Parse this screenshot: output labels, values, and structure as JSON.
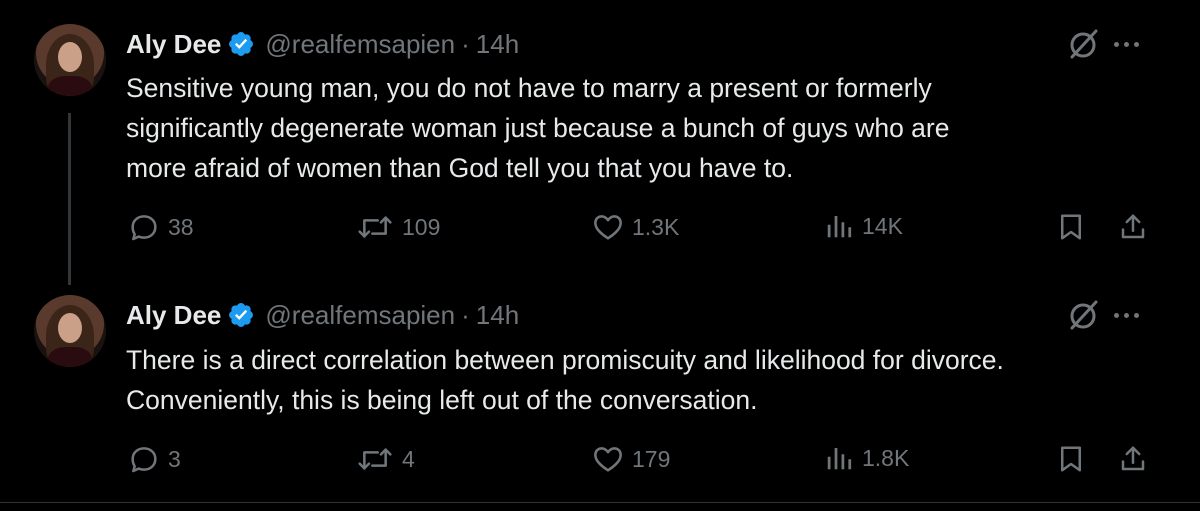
{
  "tweets": [
    {
      "name": "Aly Dee",
      "handle": "@realfemsapien",
      "separator": "·",
      "time": "14h",
      "lines": [
        "Sensitive young man, you do not have to marry a present or formerly",
        "significantly degenerate woman just because a bunch of guys who are",
        "more afraid of women than God tell you that you have to."
      ],
      "replies": "38",
      "retweets": "109",
      "likes": "1.3K",
      "views": "14K"
    },
    {
      "name": "Aly Dee",
      "handle": "@realfemsapien",
      "separator": "·",
      "time": "14h",
      "lines": [
        "There is a direct correlation between promiscuity and likelihood for divorce.",
        "Conveniently, this is being left out of the conversation."
      ],
      "replies": "3",
      "retweets": "4",
      "likes": "179",
      "views": "1.8K"
    }
  ],
  "icons": {
    "reply": "reply-icon",
    "retweet": "retweet-icon",
    "like": "heart-icon",
    "views": "views-icon",
    "bookmark": "bookmark-icon",
    "share": "share-icon",
    "grok": "grok-icon",
    "more": "more-icon",
    "verified": "verified-badge-icon"
  },
  "colors": {
    "background": "#000000",
    "text": "#e7e9ea",
    "muted": "#71767b",
    "verified": "#1d9bf0"
  }
}
